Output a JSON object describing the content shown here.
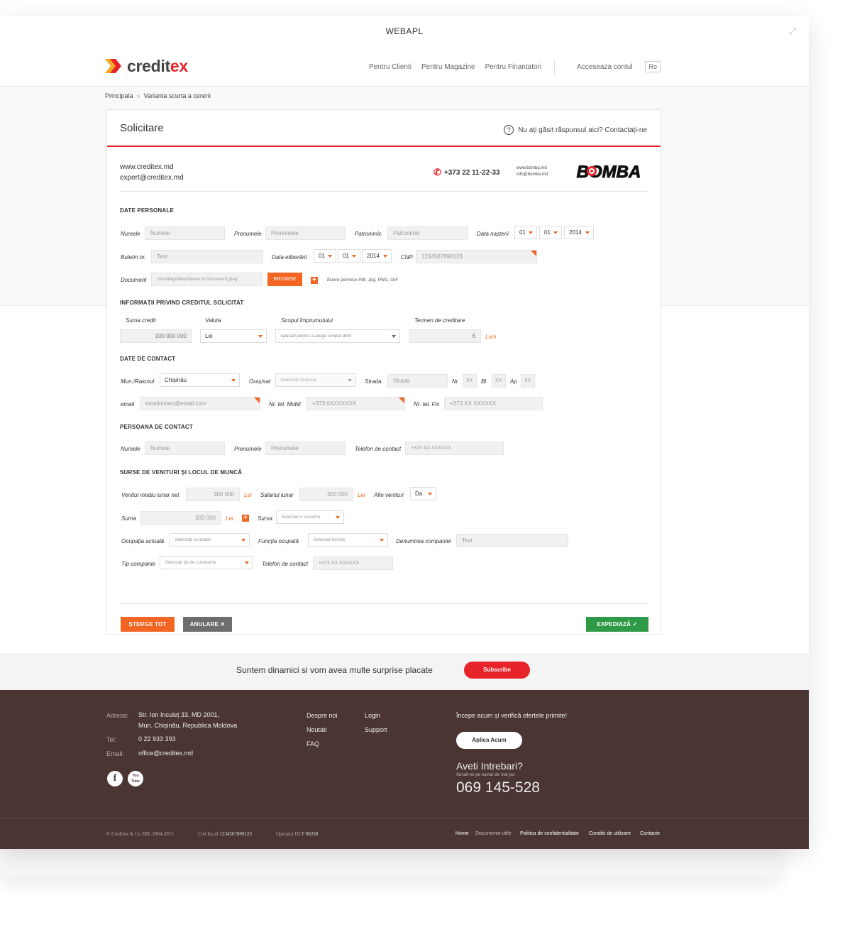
{
  "window": {
    "title": "WEBAPL"
  },
  "header": {
    "brand_a": "credit",
    "brand_b": "ex",
    "nav": [
      "Pentru Clienti",
      "Pentru Magazine",
      "Pentru Finantatori"
    ],
    "account": "Acceseaza contul",
    "lang": "Ro"
  },
  "breadcrumb": {
    "home": "Principala",
    "sep": "»",
    "current": "Varianta scurta a cererii"
  },
  "card": {
    "title": "Solicitare",
    "help": "Nu ați găsit răspunsul aici? Contactați-ne",
    "site": "www.creditex.md",
    "email": "expert@creditex.md",
    "phone": "+373 22 11-22-33",
    "partner_site": "www.bomba.md",
    "partner_email": "info@bomba.md",
    "partner_logo": "BOMBA"
  },
  "personal": {
    "section": "DATE PERSONALE",
    "name_label": "Numele",
    "name_ph": "Numele",
    "surname_label": "Prenumele",
    "surname_ph": "Prenumele",
    "patronymic_label": "Patronimic",
    "patronymic_ph": "Patronimic",
    "birth_label": "Data nașterii",
    "birth_day": "01",
    "birth_month": "01",
    "birth_year": "2014",
    "id_label": "Buletin nr.",
    "id_ph": "Text",
    "issue_label": "Data eliberării",
    "issue_day": "01",
    "issue_month": "01",
    "issue_year": "2014",
    "cnp_label": "CNP",
    "cnp_ph": "1234567890123",
    "doc_label": "Document",
    "doc_ph": "Disk/Map/Map/Name of Document.jpeg",
    "browse": "BROWSE",
    "plus": "+",
    "doc_note": "fișiere permise Pdf, Jpg, PNG, GIF."
  },
  "credit": {
    "section": "INFORMAȚII PRIVIND CREDITUL SOLICITAT",
    "amount_label": "Suma credit",
    "amount": "100 000 000",
    "currency_label": "Valuta",
    "currency": "Lei",
    "purpose_label": "Scopul împrumutului",
    "purpose_ph": "Apasati pentru a alege scopul dorit",
    "term_label": "Termen de creditare",
    "term": "6",
    "term_unit": "Luni"
  },
  "contact": {
    "section": "DATE DE CONTACT",
    "region_label": "Mun./Raionul",
    "region": "Chișinău",
    "city_label": "Oraș/sat",
    "city_ph": "Selectați Oraș/sat",
    "street_label": "Strada",
    "street_ph": "Strada",
    "nr_label": "Nr",
    "bl_label": "Bl",
    "ap_label": "Ap",
    "xx": "XX",
    "email_label": "email",
    "email_ph": "emailulmeu@email.com",
    "mobile_label": "Nr. tel. Mobil",
    "mobile_ph": "+373 6XXXXXXX",
    "fixed_label": "Nr. tel. Fix",
    "fixed_ph": "+373 XX XXXXXX"
  },
  "person": {
    "section": "PERSOANA DE CONTACT",
    "name_label": "Numele",
    "name_ph": "Numele",
    "surname_label": "Prenumele",
    "surname_ph": "Prenumele",
    "phone_label": "Telefon de contact",
    "phone_ph": "+373 XX XXXXXX"
  },
  "income": {
    "section": "SURSE DE VENITURI ȘI LOCUL DE MUNCĂ",
    "avg_label": "Venitul mediu lunar net",
    "avg": "300 000",
    "salary_label": "Salariul lunar",
    "salary": "300 000",
    "other_label": "Alte venituri",
    "other": "Da",
    "sum_label": "Suma",
    "sum": "300 000",
    "unit": "Lei",
    "source_label": "Sursa",
    "source_ph": "Selectați o varianta",
    "occupation_label": "Ocupația actuală",
    "occupation_ph": "Selectați ocupație",
    "function_label": "Funcția ocupată",
    "function_ph": "Selectați funcție",
    "company_label": "Denumirea companiei",
    "company_ph": "Text",
    "company_type_label": "Tip companie",
    "company_type_ph": "Selectați tip de companie",
    "phone_label": "Telefon de contact",
    "phone_ph": "+373 XX XXXXXX"
  },
  "actions": {
    "clear": "ȘTERGE TOT",
    "cancel": "ANULARE",
    "cancel_icon": "✕",
    "send": "EXPEDIAZĂ",
    "send_icon": "✓"
  },
  "subscribe": {
    "text": "Suntem dinamici si vom avea multe surprise placate",
    "button": "Subscribe"
  },
  "footer": {
    "address_label": "Adresa:",
    "address1": "Str. Ion Inculeț 33, MD 2001,",
    "address2": "Mun. Chișinău, Republica Moldova",
    "tel_label": "Tel:",
    "tel": "0 22 933 393",
    "email_label": "Email:",
    "email": "office@creditex.md",
    "links_col1": [
      "Despre noi",
      "Noutati",
      "FAQ"
    ],
    "links_col2": [
      "Login",
      "Support"
    ],
    "cta": "Începe acum și verifică ofertele primite!",
    "apply": "Aplica Acum",
    "questions": "Aveti Intrebari?",
    "call_note": "Sunati-ne pe numar de mai jos:",
    "big_phone": "069 145-528",
    "social_fb": "f",
    "social_yt": "You Tube"
  },
  "bottom": {
    "copyright": "© Creditex & Co SRL 2004-2015",
    "fiscal_label": "Cod fiscal",
    "fiscal": "1234567890123",
    "operator_label": "Operator DCP",
    "operator": "00268",
    "links": [
      "Home",
      "Documente utile",
      "Politica de confidentialitate",
      "Conditii de utilizare",
      "Contacte"
    ]
  }
}
